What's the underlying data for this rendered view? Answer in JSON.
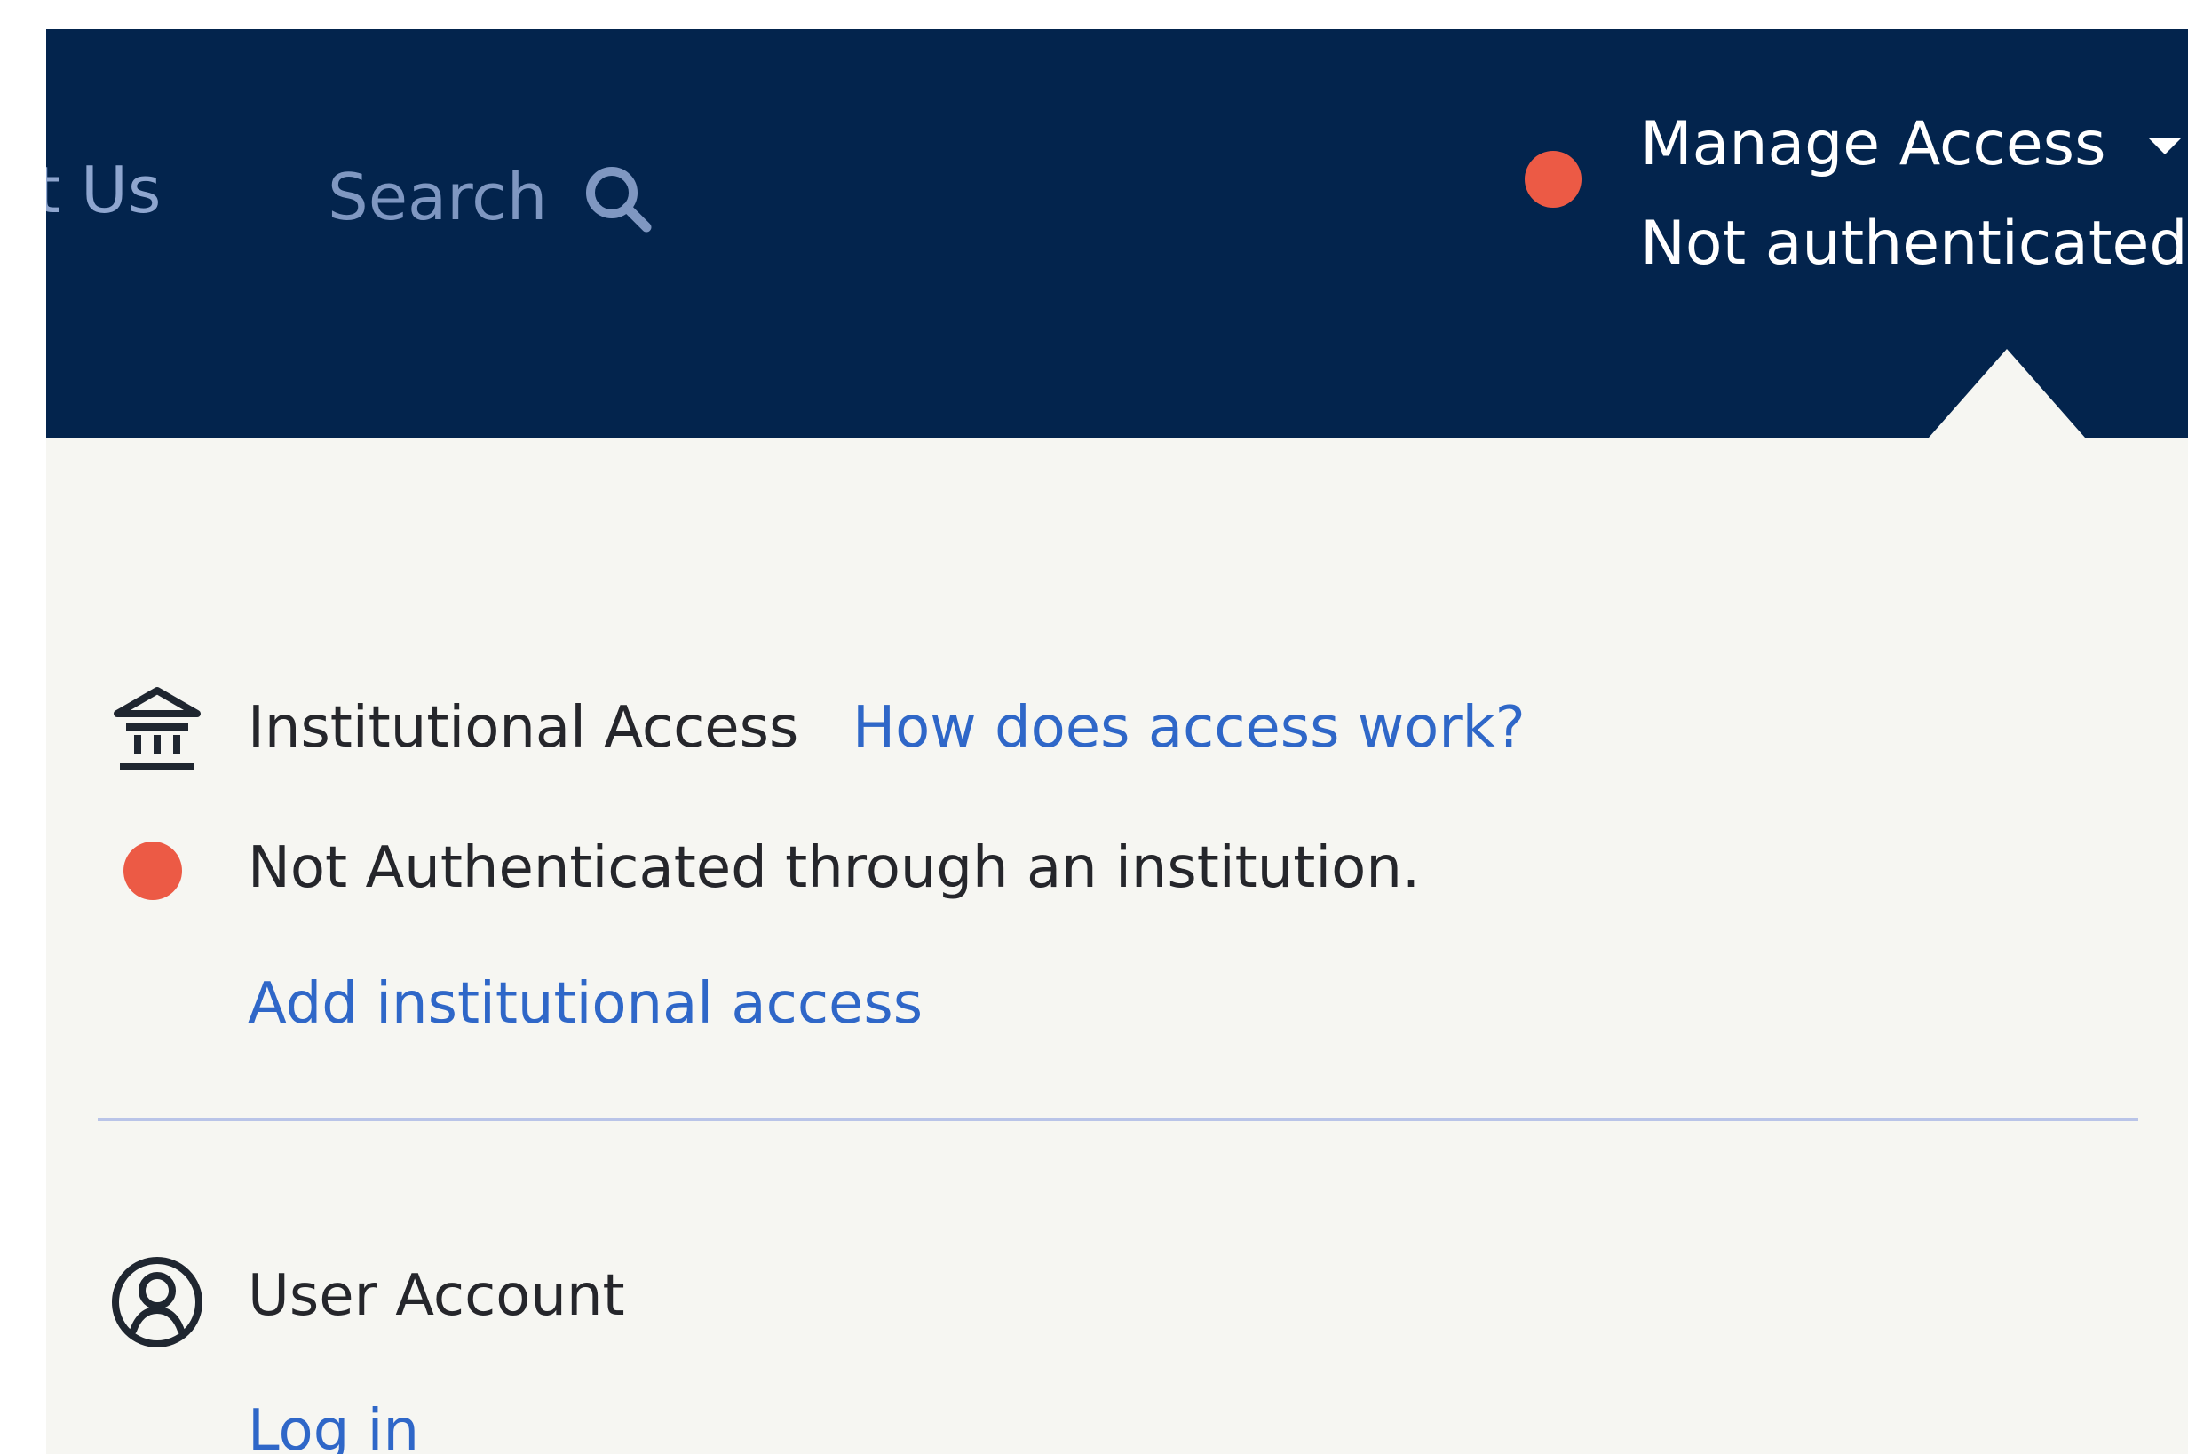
{
  "header": {
    "partial_nav_label": "t Us",
    "search_label": "Search",
    "search_icon": "search-icon",
    "status_color": "#ec5a45",
    "manage_access_label": "Manage Access",
    "manage_access_state": "Not authenticated",
    "background_color": "#03244d"
  },
  "panel": {
    "institutional_access": {
      "icon": "institution-icon",
      "label": "Institutional Access",
      "help_link": "How does access work?"
    },
    "institution_status": {
      "message": "Not Authenticated through an institution.",
      "color": "#ec5a45"
    },
    "add_access_link": "Add institutional access",
    "user_account": {
      "icon": "user-account-icon",
      "label": "User Account",
      "login_link": "Log in"
    }
  }
}
